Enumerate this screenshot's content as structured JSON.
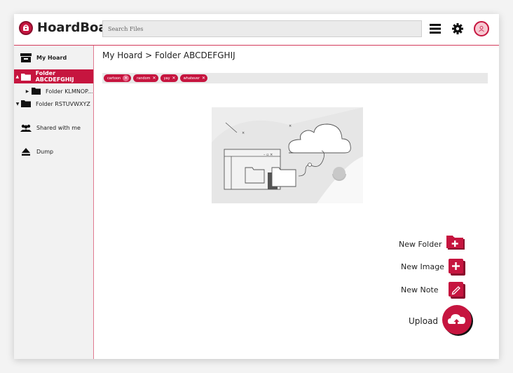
{
  "app": {
    "brand_name": "HoardBoard"
  },
  "search": {
    "placeholder": "Search Files"
  },
  "sidebar": {
    "items": [
      {
        "label": "My Hoard"
      },
      {
        "label": "Folder ABCDEFGHIJ"
      },
      {
        "label": "Folder KLMNOP..."
      },
      {
        "label": "Folder RSTUVWXYZ"
      },
      {
        "label": "Shared with me"
      },
      {
        "label": "Dump"
      }
    ]
  },
  "main": {
    "breadcrumb": "My Hoard > Folder ABCDEFGHIJ",
    "tags": [
      "cartoon",
      "random",
      "yay",
      "whatever"
    ]
  },
  "actions": {
    "new_folder": "New Folder",
    "new_image": "New Image",
    "new_note": "New Note",
    "upload": "Upload"
  },
  "colors": {
    "accent": "#c6153f",
    "dark_accent": "#8a0f2d"
  }
}
